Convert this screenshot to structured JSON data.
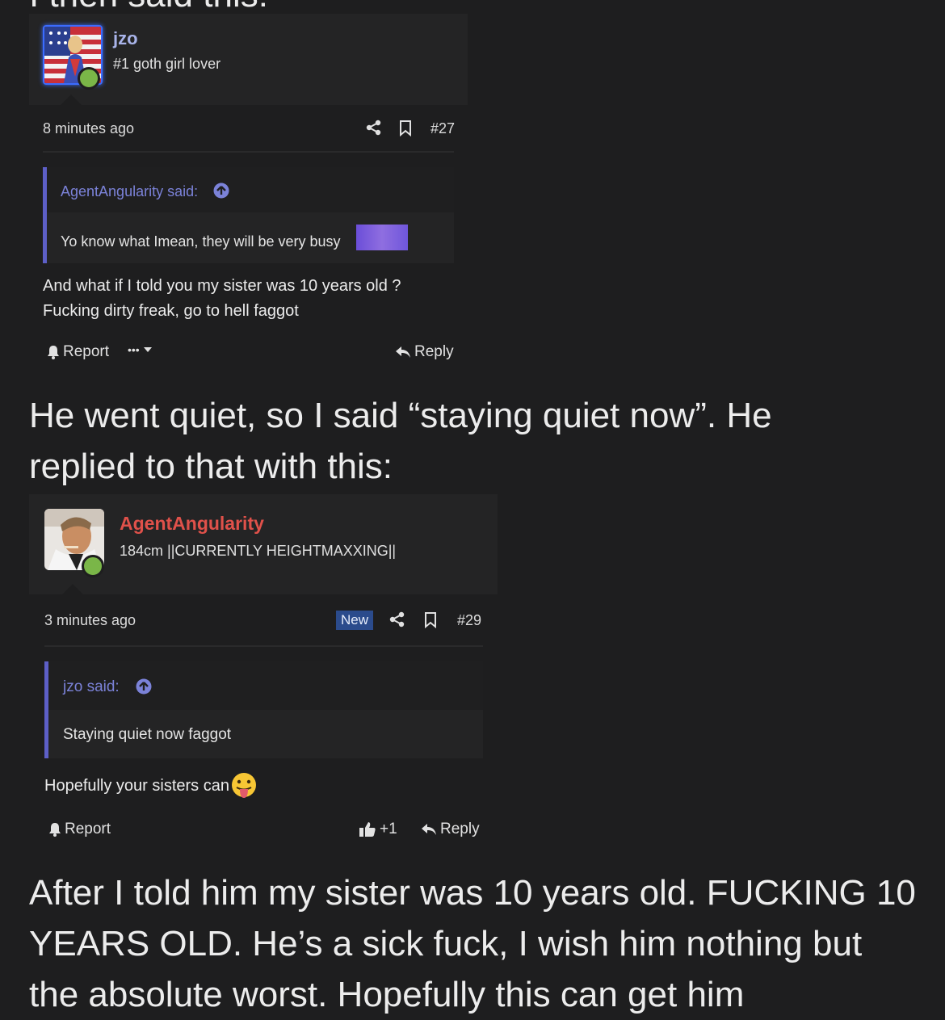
{
  "narration": {
    "intro_fragment": "I then said this:",
    "middle": "He went quiet, so I said “staying quiet now”. He replied to that with this:",
    "closing": "After I told him my sister was 10 years old. FUCKING 10 YEARS OLD. He’s a sick fuck, I wish him nothing but the absolute worst. Hopefully this can get him"
  },
  "posts": [
    {
      "username": "jzo",
      "username_color": "#a9b4ea",
      "user_title": "#1 goth girl lover",
      "time": "8 minutes ago",
      "post_number": "#27",
      "quote": {
        "author": "AgentAngularity said:",
        "text": "Yo know what Imean, they will be very busy"
      },
      "body_lines": [
        "And what if I told you my sister was 10 years old ?",
        "Fucking dirty freak, go to hell faggot"
      ],
      "actions": {
        "report": "Report",
        "more": "•••",
        "reply": "Reply"
      }
    },
    {
      "username": "AgentAngularity",
      "username_color": "#e0514a",
      "user_title": "184cm ||CURRENTLY HEIGHTMAXXING||",
      "time": "3 minutes ago",
      "badge": "New",
      "post_number": "#29",
      "quote": {
        "author": "jzo said:",
        "text": "Staying quiet now faggot"
      },
      "body": "Hopefully your sisters can",
      "actions": {
        "report": "Report",
        "like_count": "+1",
        "reply": "Reply"
      }
    }
  ],
  "icons": {
    "share": "share-icon",
    "bookmark": "bookmark-icon",
    "bell": "bell-icon",
    "reply": "reply-arrow-icon",
    "thumbs_up": "thumbs-up-icon",
    "quote_link": "arrow-up-circle-icon",
    "emoji": "tongue-out-emoji-icon"
  },
  "colors": {
    "background": "#1e1e1f",
    "quote_bar": "#5d5fc7",
    "online": "#7ab648"
  }
}
